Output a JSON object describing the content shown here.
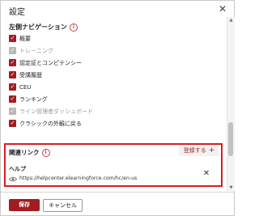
{
  "dialog": {
    "title": "設定"
  },
  "left_nav": {
    "section_title": "左側ナビゲーション",
    "items": [
      {
        "label": "概要",
        "checked": true,
        "disabled": false
      },
      {
        "label": "トレーニング",
        "checked": true,
        "disabled": true
      },
      {
        "label": "認定証とコンピテンシー",
        "checked": true,
        "disabled": false
      },
      {
        "label": "受講履歴",
        "checked": true,
        "disabled": false
      },
      {
        "label": "CEU",
        "checked": true,
        "disabled": false
      },
      {
        "label": "ランキング",
        "checked": true,
        "disabled": false
      },
      {
        "label": "ライン管理者ダッシュボード",
        "checked": true,
        "disabled": true
      },
      {
        "label": "クラシックの外観に戻る",
        "checked": true,
        "disabled": false
      }
    ]
  },
  "related_links": {
    "section_title": "関連リンク",
    "register_label": "登録する",
    "links": [
      {
        "name": "ヘルプ",
        "url": "https://helpcenter.elearningforce.com/hc/en-us"
      }
    ]
  },
  "footer": {
    "save_label": "保存",
    "cancel_label": "キャンセル"
  },
  "colors": {
    "accent": "#a31c22",
    "highlight_border": "#d61e1e",
    "disabled": "#b8b8b8"
  }
}
